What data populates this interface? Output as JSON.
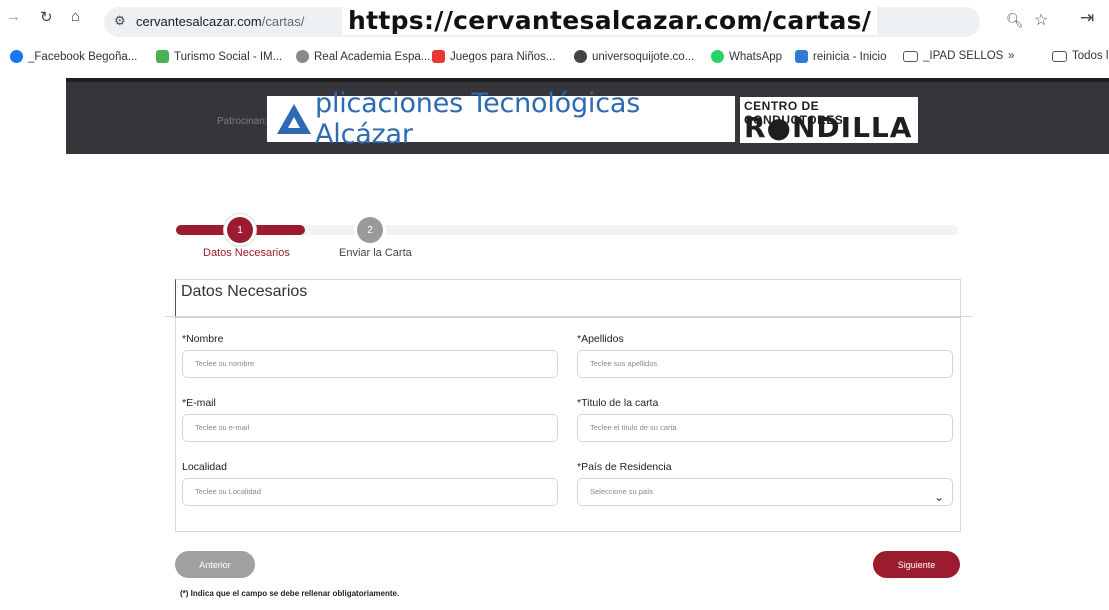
{
  "browser": {
    "url_host": "cervantesalcazar.com",
    "url_path": "/cartas/",
    "overlay_url": "https://cervantesalcazar.com/cartas/",
    "bookmarks": [
      {
        "label": "_Facebook Begoña...",
        "color": "#1877f2"
      },
      {
        "label": "Turismo Social - IM...",
        "color": "#4caf50"
      },
      {
        "label": "Real Academia Espa...",
        "color": "#8a8a8a"
      },
      {
        "label": "Juegos para Niños...",
        "color": "#e53935"
      },
      {
        "label": "universoquijote.co...",
        "color": "#444444"
      },
      {
        "label": "WhatsApp",
        "color": "#25d366"
      },
      {
        "label": "reinicia - Inicio",
        "color": "#2d7dd2"
      },
      {
        "label": "_IPAD SELLOS",
        "color": "#ffffff"
      },
      {
        "label": "»",
        "color": "#ffffff"
      },
      {
        "label": "Todos l",
        "color": "#ffffff"
      }
    ]
  },
  "header": {
    "sponsor_label": "Patrocinan:",
    "sponsor1": "plicaciones Tecnológicas Alcázar",
    "sponsor2_top": "CENTRO DE CONDUCTORES",
    "sponsor2_bottom": "R●NDILLA"
  },
  "steps": [
    {
      "number": "1",
      "label": "Datos Necesarios"
    },
    {
      "number": "2",
      "label": "Enviar la Carta"
    }
  ],
  "form": {
    "title": "Datos Necesarios",
    "fields": {
      "nombre": {
        "label": "*Nombre",
        "placeholder": "Teclee su nombre"
      },
      "apellidos": {
        "label": "*Apellidos",
        "placeholder": "Teclee sus apellidos"
      },
      "email": {
        "label": "*E-mail",
        "placeholder": "Teclee su e-mail"
      },
      "titulo": {
        "label": "*Titulo de la carta",
        "placeholder": "Teclee el titulo de su carta"
      },
      "localidad": {
        "label": "Localidad",
        "placeholder": "Teclee su Localidad"
      },
      "pais": {
        "label": "*País de Residencia",
        "placeholder": "Seleccione su país"
      }
    },
    "prev_button": "Anterior",
    "next_button": "Siguiente",
    "required_note": "(*) Indica que el campo se debe rellenar obligatoriamente."
  },
  "colors": {
    "accent": "#9b1c2e",
    "inactive": "#9a9a9a",
    "header_bg": "#36363a",
    "sponsor_blue": "#2d6ab3"
  }
}
